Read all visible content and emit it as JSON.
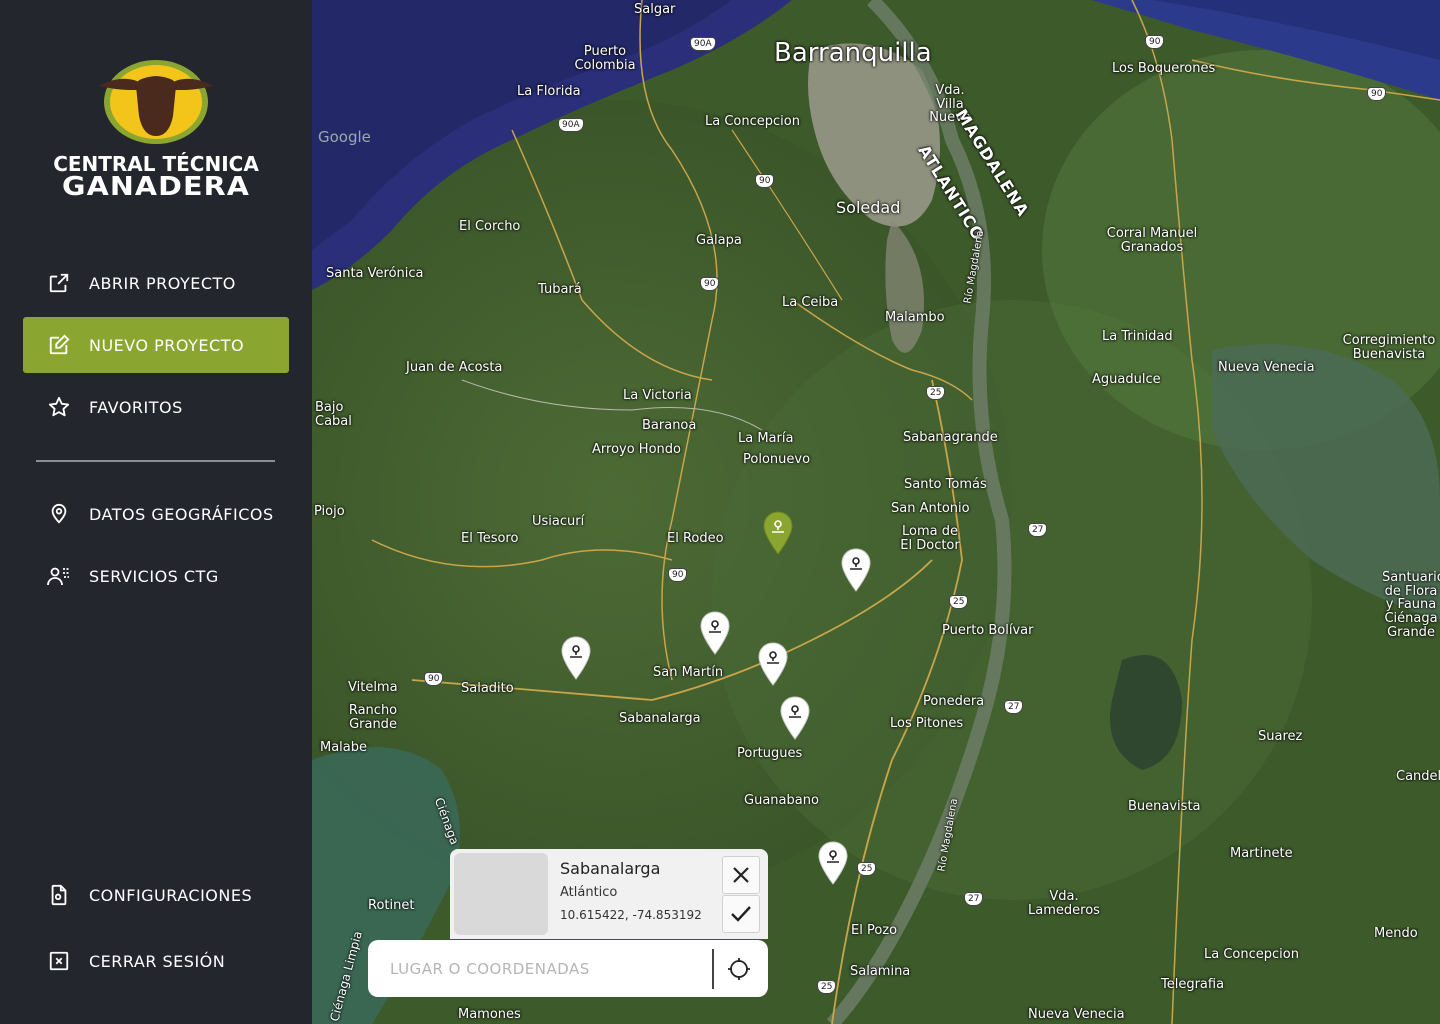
{
  "brand": {
    "line1": "CENTRAL TÉCNICA",
    "line2": "GANADERA",
    "colors": {
      "yellow": "#f3c51b",
      "green": "#8aa630",
      "brown": "#4a2a1c"
    }
  },
  "nav": {
    "primary": [
      {
        "label": "ABRIR PROYECTO",
        "icon": "open-external-icon",
        "active": false
      },
      {
        "label": "NUEVO PROYECTO",
        "icon": "edit-note-icon",
        "active": true
      },
      {
        "label": "FAVORITOS",
        "icon": "star-icon",
        "active": false
      }
    ],
    "secondary": [
      {
        "label": "DATOS GEOGRÁFICOS",
        "icon": "map-pin-person-icon"
      },
      {
        "label": "SERVICIOS CTG",
        "icon": "users-icon"
      }
    ],
    "bottom": [
      {
        "label": "CONFIGURACIONES",
        "icon": "settings-file-icon"
      },
      {
        "label": "CERRAR SESIÓN",
        "icon": "close-box-icon"
      }
    ]
  },
  "map": {
    "watermark": "Google",
    "places": [
      {
        "name": "Salgar"
      },
      {
        "name": "Puerto Colombia"
      },
      {
        "name": "Barranquilla"
      },
      {
        "name": "Vda. Villa Nueva"
      },
      {
        "name": "Los Boquerones"
      },
      {
        "name": "La Florida"
      },
      {
        "name": "La Concepcion"
      },
      {
        "name": "MAGDALENA"
      },
      {
        "name": "ATLANTICO"
      },
      {
        "name": "Soledad"
      },
      {
        "name": "El Corcho"
      },
      {
        "name": "Galapa"
      },
      {
        "name": "Corral Manuel Granados"
      },
      {
        "name": "Santa Verónica"
      },
      {
        "name": "Tubará"
      },
      {
        "name": "La Ceiba"
      },
      {
        "name": "Malambo"
      },
      {
        "name": "La Trinidad"
      },
      {
        "name": "Corregimiento Buenavista"
      },
      {
        "name": "Juan de Acosta"
      },
      {
        "name": "Aguadulce"
      },
      {
        "name": "Nueva Venecia"
      },
      {
        "name": "Bajo Cabal"
      },
      {
        "name": "La Victoria"
      },
      {
        "name": "Baranoa"
      },
      {
        "name": "La María"
      },
      {
        "name": "Polonuevo"
      },
      {
        "name": "Sabanagrande"
      },
      {
        "name": "Arroyo Hondo"
      },
      {
        "name": "Santo Tomás"
      },
      {
        "name": "San Antonio"
      },
      {
        "name": "Loma de El Doctor"
      },
      {
        "name": "Piojo"
      },
      {
        "name": "Usiacurí"
      },
      {
        "name": "El Tesoro"
      },
      {
        "name": "El Rodeo"
      },
      {
        "name": "Santuario de Flora y Fauna Ciénaga Grande"
      },
      {
        "name": "Puerto Bolívar"
      },
      {
        "name": "San Martín"
      },
      {
        "name": "Vitelma"
      },
      {
        "name": "Saladito"
      },
      {
        "name": "Ponedera"
      },
      {
        "name": "Rancho Grande"
      },
      {
        "name": "Sabanalarga"
      },
      {
        "name": "Los Pitones"
      },
      {
        "name": "Malabe"
      },
      {
        "name": "Portugues"
      },
      {
        "name": "Suarez"
      },
      {
        "name": "Candelaria"
      },
      {
        "name": "Guanabano"
      },
      {
        "name": "Buenavista"
      },
      {
        "name": "Martinete"
      },
      {
        "name": "Rotinet"
      },
      {
        "name": "Vda. Lamederos"
      },
      {
        "name": "El Pozo"
      },
      {
        "name": "Mendoza"
      },
      {
        "name": "La Concepcion"
      },
      {
        "name": "Salamina"
      },
      {
        "name": "Telegrafia"
      },
      {
        "name": "Mamones"
      },
      {
        "name": "Nueva Venecia"
      },
      {
        "name": "Río Magdalena"
      },
      {
        "name": "Ciénaga"
      },
      {
        "name": "Ciénaga Limpia"
      }
    ],
    "road_shields": [
      "90A",
      "90A",
      "90",
      "90",
      "90",
      "90",
      "25",
      "27",
      "25",
      "27",
      "90",
      "90",
      "25",
      "27",
      "25",
      "90"
    ]
  },
  "popup": {
    "title": "Sabanalarga",
    "subtitle": "Atlántico",
    "coords": "10.615422, -74.853192"
  },
  "search": {
    "placeholder": "LUGAR O COORDENADAS"
  },
  "zoom": {
    "in": "+",
    "out": "−"
  }
}
